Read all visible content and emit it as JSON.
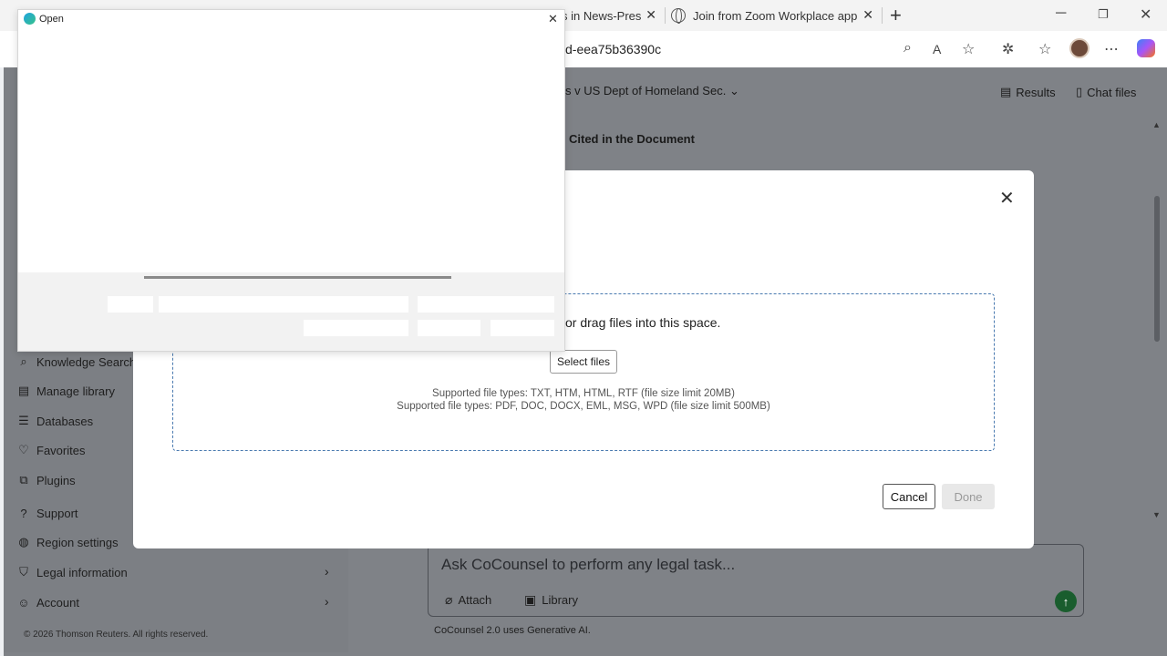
{
  "browser": {
    "tabs": [
      {
        "label": "s in News-Pres"
      },
      {
        "label": "Join from Zoom Workplace app"
      }
    ],
    "url_fragment": "d-eea75b36390c"
  },
  "app": {
    "matter_title": "s v US Dept of Homeland Sec.",
    "section_heading": "Cited in the Document",
    "top_links": {
      "results": "Results",
      "chat_files": "Chat files"
    },
    "sidebar": {
      "items": [
        {
          "label": "Knowledge Search"
        },
        {
          "label": "Manage library"
        },
        {
          "label": "Databases"
        },
        {
          "label": "Favorites"
        },
        {
          "label": "Plugins"
        },
        {
          "label": "Support"
        },
        {
          "label": "Region settings"
        },
        {
          "label": "Legal information"
        },
        {
          "label": "Account"
        }
      ],
      "copyright": "© 2026 Thomson Reuters. All rights reserved."
    },
    "chat": {
      "placeholder": "Ask CoCounsel to perform any legal task...",
      "attach": "Attach",
      "library": "Library",
      "disclaimer": "CoCounsel 2.0 uses Generative AI."
    }
  },
  "modal": {
    "drag_text": "or drag files into this space.",
    "select_files": "Select files",
    "supported_1": "Supported file types: TXT, HTM, HTML, RTF (file size limit 20MB)",
    "supported_2": "Supported file types: PDF, DOC, DOCX, EML, MSG, WPD (file size limit 500MB)",
    "cancel": "Cancel",
    "done": "Done"
  },
  "open_dialog": {
    "title": "Open"
  }
}
